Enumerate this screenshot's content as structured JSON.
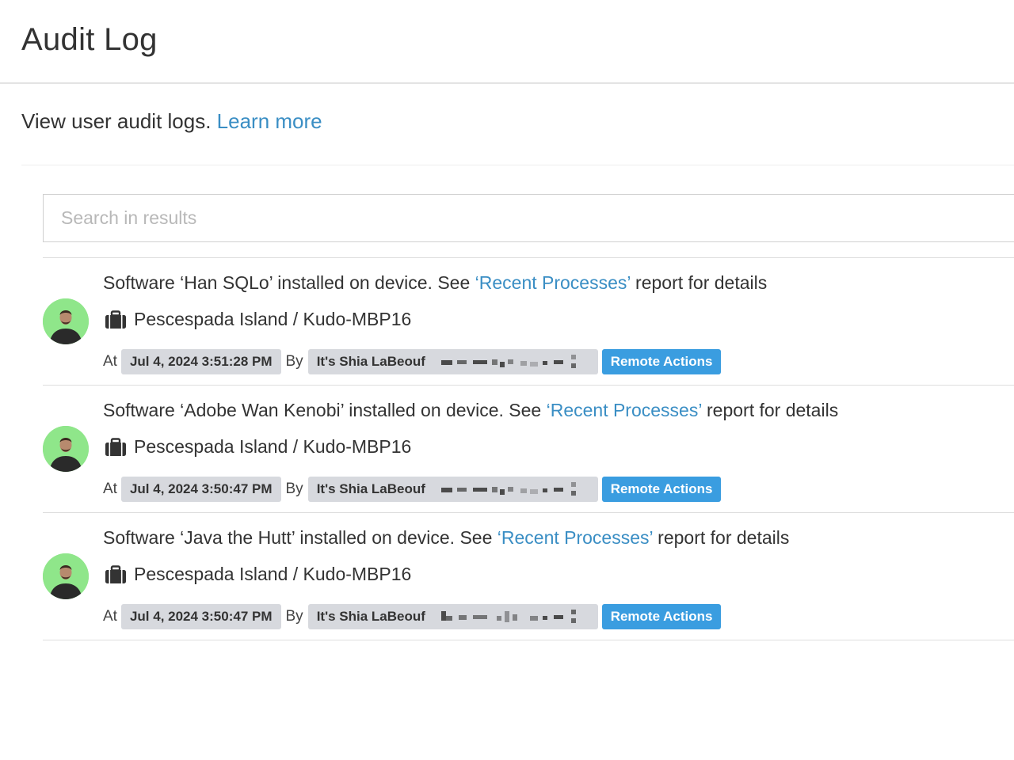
{
  "header": {
    "title": "Audit Log"
  },
  "intro": {
    "text": "View user audit logs.",
    "link": "Learn more"
  },
  "search": {
    "placeholder": "Search in results",
    "value": ""
  },
  "labels": {
    "at": "At",
    "by": "By"
  },
  "entries": [
    {
      "prefix": "Software ‘Han SQLo’ installed on device. See ",
      "link": "‘Recent Processes’",
      "suffix": " report for details",
      "location": "Pescespada Island / Kudo-MBP16",
      "timestamp": "Jul 4, 2024 3:51:28 PM",
      "user": "It's Shia LaBeouf",
      "action": "Remote Actions"
    },
    {
      "prefix": "Software ‘Adobe Wan Kenobi’ installed on device. See ",
      "link": "‘Recent Processes’",
      "suffix": " report for details",
      "location": "Pescespada Island / Kudo-MBP16",
      "timestamp": "Jul 4, 2024 3:50:47 PM",
      "user": "It's Shia LaBeouf",
      "action": "Remote Actions"
    },
    {
      "prefix": "Software ‘Java the Hutt’ installed on device. See ",
      "link": "‘Recent Processes’",
      "suffix": " report for details",
      "location": "Pescespada Island / Kudo-MBP16",
      "timestamp": "Jul 4, 2024 3:50:47 PM",
      "user": "It's Shia LaBeouf",
      "action": "Remote Actions"
    }
  ],
  "icons": {
    "location": "briefcase-icon",
    "avatar": "user-avatar"
  },
  "colors": {
    "link": "#3a8ec4",
    "button": "#3a9de0",
    "pill": "#d7d9de",
    "avatar_bg": "#8fe68a"
  }
}
